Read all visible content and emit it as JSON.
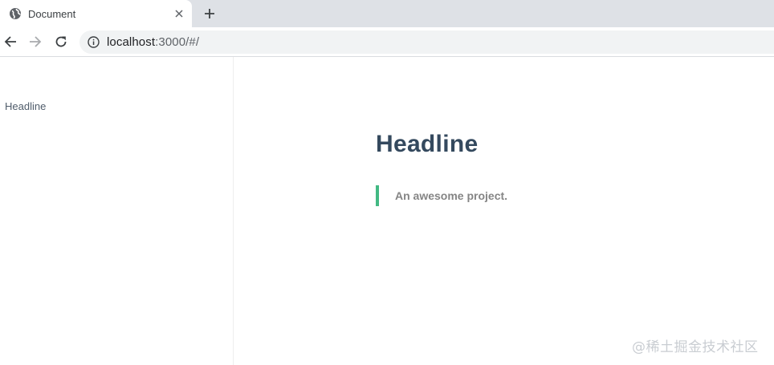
{
  "browser": {
    "tab": {
      "title": "Document"
    },
    "address_bar": {
      "host": "localhost",
      "rest": ":3000/#/"
    }
  },
  "sidebar": {
    "items": [
      {
        "label": "Headline"
      }
    ]
  },
  "main": {
    "headline": "Headline",
    "blockquote": "An awesome project."
  },
  "watermark": "@稀土掘金技术社区",
  "colors": {
    "accent": "#42b983",
    "heading": "#34495e",
    "quote_text": "#858585",
    "sidebar_text": "#505d6b"
  }
}
